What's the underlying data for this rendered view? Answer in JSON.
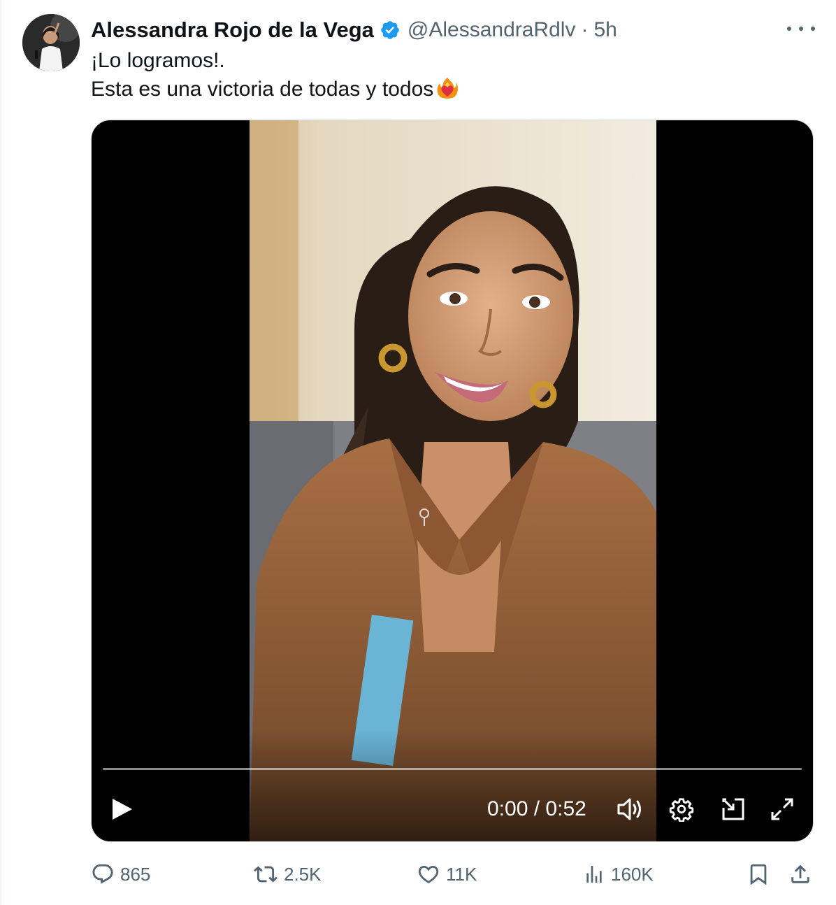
{
  "author": {
    "display_name": "Alessandra Rojo de la Vega",
    "handle": "@AlessandraRdlv",
    "separator": "·",
    "time_ago": "5h",
    "verified": true,
    "verified_color": "#1d9bf0"
  },
  "tweet": {
    "lines": [
      "¡Lo logramos!.",
      "Esta es una victoria de todas y todos"
    ],
    "emoji": "heart-on-fire-icon"
  },
  "video": {
    "current_time": "0:00",
    "time_separator": "/",
    "duration": "0:52",
    "progress": 0
  },
  "actions": {
    "replies": "865",
    "reposts": "2.5K",
    "likes": "11K",
    "views": "160K"
  },
  "colors": {
    "text_primary": "#0f1419",
    "text_secondary": "#536471",
    "accent": "#1d9bf0"
  }
}
